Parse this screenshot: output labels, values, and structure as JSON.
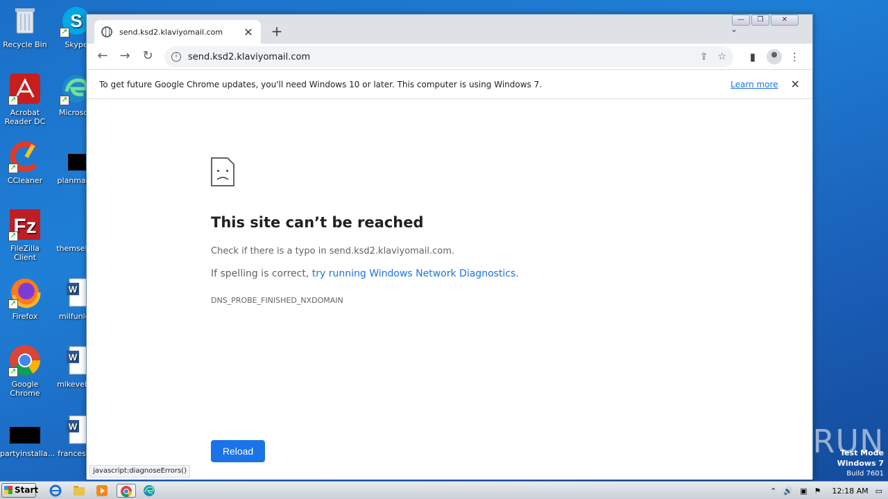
{
  "desktop": {
    "icons": [
      {
        "label": "Recycle Bin"
      },
      {
        "label": "Skype"
      },
      {
        "label": "Acrobat Reader DC"
      },
      {
        "label": "Microsoft"
      },
      {
        "label": "CCleaner"
      },
      {
        "label": "planmana"
      },
      {
        "label": "FileZilla Client"
      },
      {
        "label": "themselve"
      },
      {
        "label": "Firefox"
      },
      {
        "label": "milfunles"
      },
      {
        "label": "Google Chrome"
      },
      {
        "label": "mikevehic"
      },
      {
        "label": "partyinstalla..."
      },
      {
        "label": "francesell"
      }
    ]
  },
  "browser": {
    "tab_title": "send.ksd2.klaviyomail.com",
    "tab_close": "✕",
    "new_tab": "+",
    "tab_search": "⌄",
    "address": "send.ksd2.klaviyomail.com",
    "infobar": {
      "message": "To get future Google Chrome updates, you'll need Windows 10 or later. This computer is using Windows 7.",
      "learn_more": "Learn more",
      "close": "✕"
    },
    "error": {
      "title": "This site can’t be reached",
      "line1": "Check if there is a typo in send.ksd2.klaviyomail.com.",
      "line2_prefix": "If spelling is correct, ",
      "line2_link": "try running Windows Network Diagnostics",
      "line2_suffix": ".",
      "code": "DNS_PROBE_FINISHED_NXDOMAIN",
      "reload": "Reload"
    },
    "status_text": "javascript:diagnoseErrors()"
  },
  "watermark": {
    "text": "ANY▷RUN",
    "test_mode": "Test Mode",
    "os": "Windows 7",
    "build": "Build 7601"
  },
  "taskbar": {
    "start": "Start",
    "clock": "12:18 AM"
  },
  "colors": {
    "accent": "#1a73e8",
    "desktop": "#1f7fd6"
  }
}
